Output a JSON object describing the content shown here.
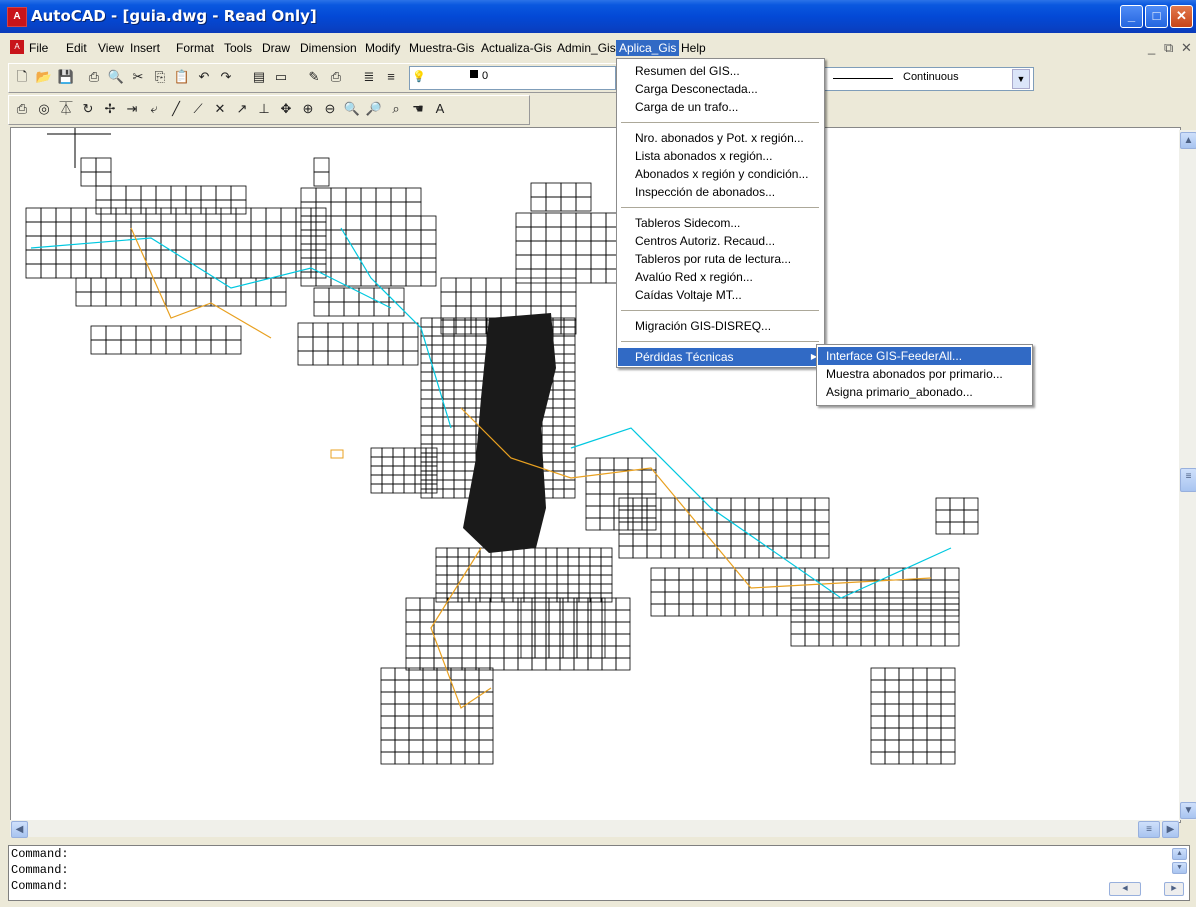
{
  "window": {
    "title": "AutoCAD - [guia.dwg - Read Only]",
    "app_icon": "autocad-icon"
  },
  "menubar": {
    "items": [
      "File",
      "Edit",
      "View",
      "Insert",
      "Format",
      "Tools",
      "Draw",
      "Dimension",
      "Modify",
      "Muestra-Gis",
      "Actualiza-Gis",
      "Admin_Gis",
      "Aplica_Gis",
      "Help"
    ],
    "active": "Aplica_Gis"
  },
  "toolbar": {
    "layer_value": "0",
    "linetype_value": "Continuous"
  },
  "aplica_menu": {
    "groups": [
      [
        "Resumen del GIS...",
        "Carga Desconectada...",
        "Carga de un trafo..."
      ],
      [
        "Nro. abonados y Pot. x región...",
        "Lista abonados x región...",
        "Abonados x región y condición...",
        "Inspección de abonados..."
      ],
      [
        "Tableros Sidecom...",
        "Centros Autoriz. Recaud...",
        "Tableros por ruta de lectura...",
        "Avalúo Red x región...",
        "Caídas Voltaje MT..."
      ],
      [
        "Migración GIS-DISREQ..."
      ],
      [
        "Pérdidas Técnicas"
      ]
    ]
  },
  "perdidas_submenu": {
    "items": [
      "Interface GIS-FeederAll...",
      "Muestra abonados por primario...",
      "Asigna primario_abonado..."
    ]
  },
  "command": {
    "lines": [
      "Command:",
      "Command:",
      "Command:"
    ]
  },
  "colors": {
    "title_blue": "#0a58df",
    "highlight": "#316ac5",
    "map_grid": "#000000",
    "map_lines_cyan": "#00c8e0",
    "map_lines_orange": "#e8a020"
  }
}
